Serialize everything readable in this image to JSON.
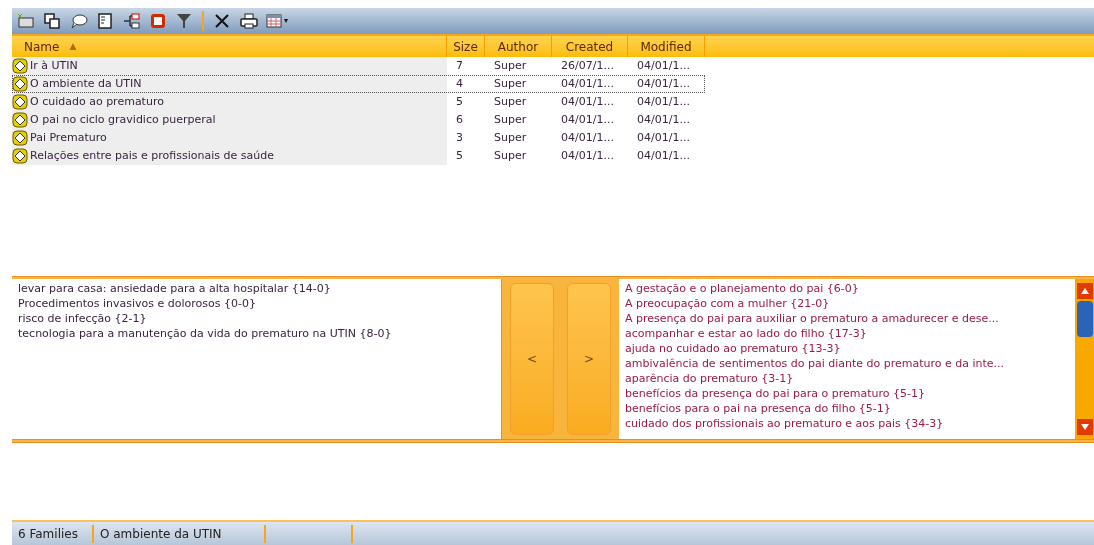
{
  "toolbar": {
    "menu_caret": "▾"
  },
  "table": {
    "columns": [
      {
        "label": "Name",
        "sorted": true,
        "sort_arrow": "▲"
      },
      {
        "label": "Size",
        "sorted": false
      },
      {
        "label": "Author",
        "sorted": false
      },
      {
        "label": "Created",
        "sorted": false
      },
      {
        "label": "Modified",
        "sorted": false
      }
    ],
    "rows": [
      {
        "name": "Ir à UTIN",
        "size": "7",
        "author": "Super",
        "created": "26/07/1...",
        "modified": "04/01/1...",
        "selected": false
      },
      {
        "name": "O ambiente da UTIN",
        "size": "4",
        "author": "Super",
        "created": "04/01/1...",
        "modified": "04/01/1...",
        "selected": true
      },
      {
        "name": "O cuidado ao prematuro",
        "size": "5",
        "author": "Super",
        "created": "04/01/1...",
        "modified": "04/01/1...",
        "selected": false
      },
      {
        "name": "O pai no ciclo gravidico puerperal",
        "size": "6",
        "author": "Super",
        "created": "04/01/1...",
        "modified": "04/01/1...",
        "selected": false
      },
      {
        "name": "Pai Prematuro",
        "size": "3",
        "author": "Super",
        "created": "04/01/1...",
        "modified": "04/01/1...",
        "selected": false
      },
      {
        "name": "Relações entre pais e profissionais de saúde",
        "size": "5",
        "author": "Super",
        "created": "04/01/1...",
        "modified": "04/01/1...",
        "selected": false
      }
    ]
  },
  "members": [
    "levar para casa: ansiedade para a alta hospitalar {14-0}",
    "Procedimentos invasivos e dolorosos {0-0}",
    "risco de infecção {2-1}",
    "tecnologia para a manutenção da vida do prematuro na UTIN {8-0}"
  ],
  "buttons": [
    "<",
    ">"
  ],
  "available": [
    "A gestação e o planejamento do pai {6-0}",
    "A preocupação com a mulher {21-0}",
    "A presença do pai para auxiliar o prematuro a amadurecer e dese...",
    "acompanhar e estar ao lado do filho {17-3}",
    "ajuda no cuidado ao prematuro {13-3}",
    "ambivalência de sentimentos do pai diante do prematuro e da inte...",
    "aparência do prematuro {3-1}",
    "benefícios da presença do pai para o prematuro {5-1}",
    "benefícios para o pai na presença do filho {5-1}",
    "cuidado dos profissionais ao prematuro e aos pais {34-3}"
  ],
  "status_bar": [
    "6 Families",
    "O ambiente da UTIN"
  ]
}
